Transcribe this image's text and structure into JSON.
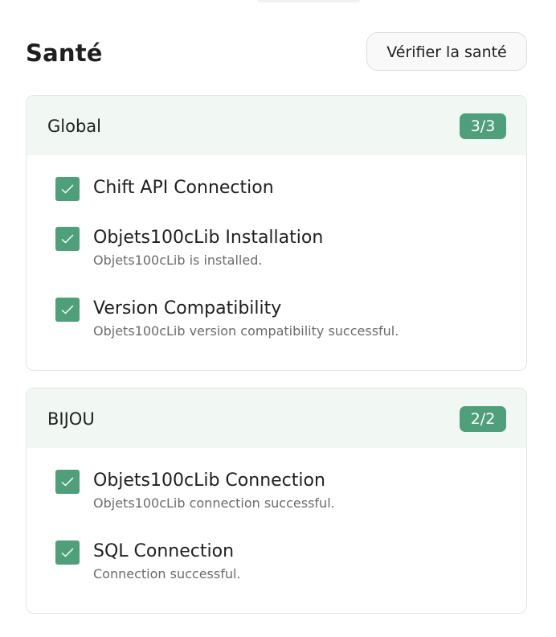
{
  "header": {
    "title": "Santé",
    "check_button_label": "Vérifier la santé"
  },
  "colors": {
    "accent": "#4f9f7b",
    "card_header_bg": "#f1f8f4",
    "subtitle_text": "#6b6b6b"
  },
  "icons": {
    "checkbox": "check-icon"
  },
  "sections": [
    {
      "title": "Global",
      "badge": "3/3",
      "items": [
        {
          "title": "Chift API Connection",
          "subtitle": "",
          "checked": true
        },
        {
          "title": "Objets100cLib Installation",
          "subtitle": "Objets100cLib is installed.",
          "checked": true
        },
        {
          "title": "Version Compatibility",
          "subtitle": "Objets100cLib version compatibility successful.",
          "checked": true
        }
      ]
    },
    {
      "title": "BIJOU",
      "badge": "2/2",
      "items": [
        {
          "title": "Objets100cLib Connection",
          "subtitle": "Objets100cLib connection successful.",
          "checked": true
        },
        {
          "title": "SQL Connection",
          "subtitle": "Connection successful.",
          "checked": true
        }
      ]
    }
  ]
}
